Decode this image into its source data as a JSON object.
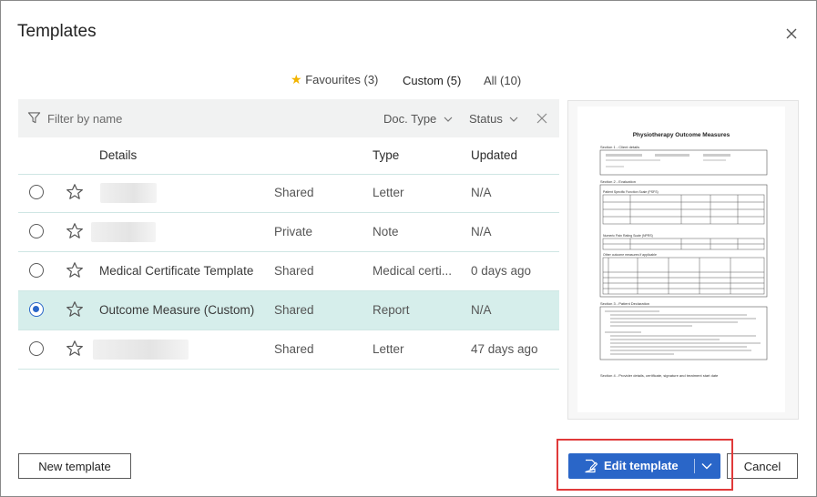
{
  "dialog": {
    "title": "Templates"
  },
  "tabs": [
    {
      "label": "Favourites (3)",
      "active": false
    },
    {
      "label": "Custom (5)",
      "active": true
    },
    {
      "label": "All (10)",
      "active": false
    }
  ],
  "filter": {
    "placeholder": "Filter by name",
    "doc_type": "Doc. Type",
    "status": "Status"
  },
  "columns": {
    "details": "Details",
    "type": "Type",
    "updated": "Updated"
  },
  "rows": [
    {
      "name": "",
      "sharing": "Shared",
      "type": "Letter",
      "updated": "N/A",
      "selected": false
    },
    {
      "name": "",
      "sharing": "Private",
      "type": "Note",
      "updated": "N/A",
      "selected": false
    },
    {
      "name": "Medical Certificate Template",
      "sharing": "Shared",
      "type": "Medical certi...",
      "updated": "0 days ago",
      "selected": false
    },
    {
      "name": "Outcome Measure (Custom)",
      "sharing": "Shared",
      "type": "Report",
      "updated": "N/A",
      "selected": true
    },
    {
      "name": "",
      "sharing": "Shared",
      "type": "Letter",
      "updated": "47 days ago",
      "selected": false
    }
  ],
  "preview": {
    "title": "Physiotherapy Outcome Measures",
    "section1": "Section 1 - Client details",
    "section2": "Section 2 - Evaluation",
    "psfs": "Patient Specific Function Scale (PSFS)",
    "nprs": "Numeric Pain Rating Scale (NPRS)",
    "other": "Other outcome measures if applicable",
    "section3": "Section 3 - Patient Declaration",
    "section4": "Section 4 - Provider details, certificate, signature and treatment start date"
  },
  "footer": {
    "new_template": "New template",
    "edit_template": "Edit template",
    "cancel": "Cancel"
  },
  "colors": {
    "accent": "#2a66c8",
    "selected_row": "#d6eeeb",
    "highlight": "#e03a3a",
    "favourite": "#f2b400"
  }
}
